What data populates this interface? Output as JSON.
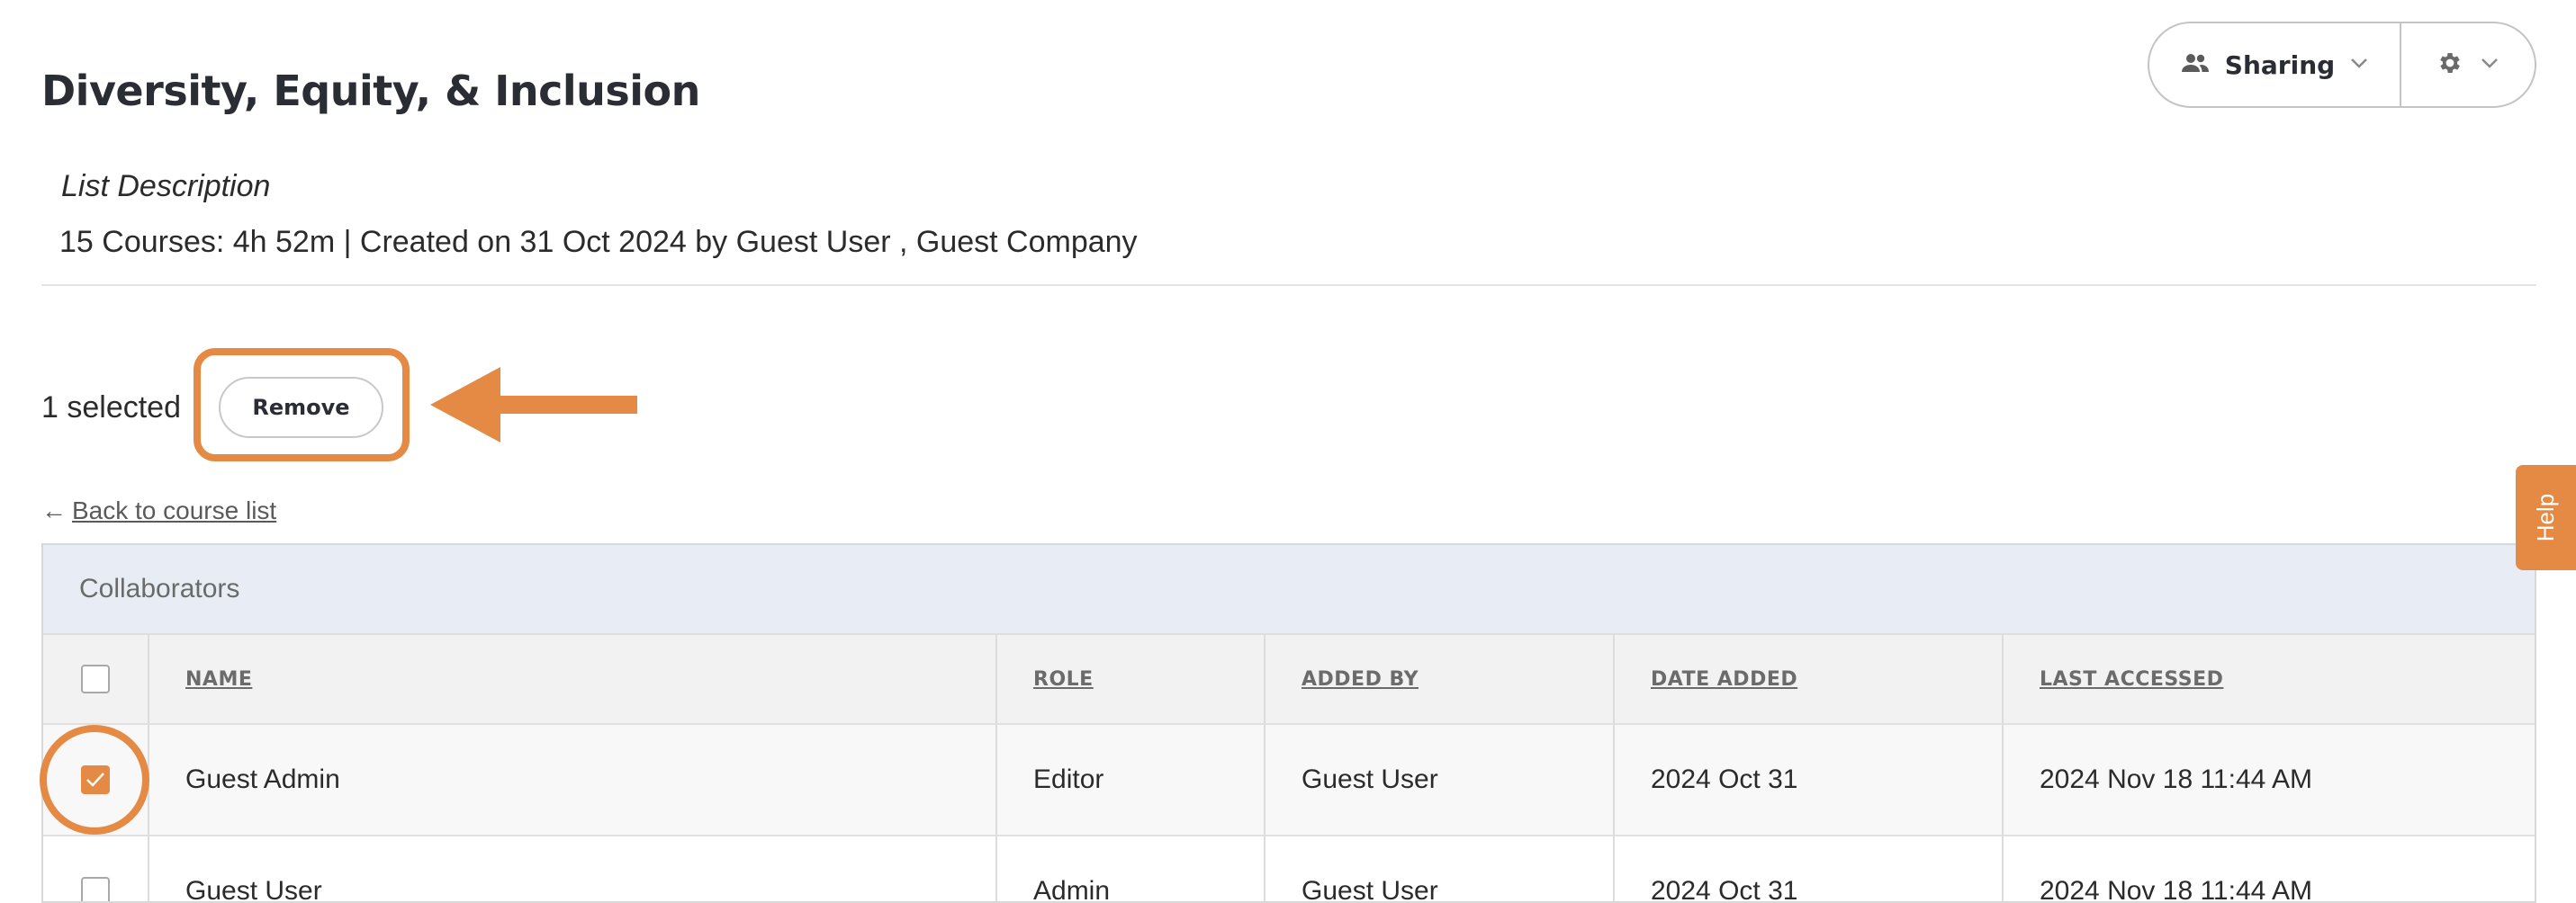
{
  "header": {
    "title": "Diversity, Equity, & Inclusion",
    "sharing_label": "Sharing",
    "icons": {
      "sharing": "people-icon",
      "sharing_chevron": "chevron-down-icon",
      "settings": "gear-icon",
      "settings_chevron": "chevron-down-icon"
    }
  },
  "list": {
    "description_label": "List Description",
    "meta": "15 Courses: 4h 52m | Created on 31 Oct 2024 by Guest User , Guest Company"
  },
  "selection": {
    "count_label": "1 selected",
    "remove_label": "Remove"
  },
  "nav": {
    "back_arrow": "←",
    "back_label": "Back to course list"
  },
  "table": {
    "caption": "Collaborators",
    "columns": [
      "NAME",
      "ROLE",
      "ADDED BY",
      "DATE ADDED",
      "LAST ACCESSED"
    ],
    "rows": [
      {
        "checked": true,
        "name": "Guest Admin",
        "role": "Editor",
        "added_by": "Guest User",
        "date_added": "2024 Oct 31",
        "last_accessed": "2024 Nov 18 11:44 AM"
      },
      {
        "checked": false,
        "name": "Guest User",
        "role": "Admin",
        "added_by": "Guest User",
        "date_added": "2024 Oct 31",
        "last_accessed": "2024 Nov 18 11:44 AM"
      }
    ]
  },
  "help": {
    "label": "Help"
  },
  "colors": {
    "accent": "#e58a45",
    "caption_bg": "#e8edf5",
    "header_bg": "#f2f2f2"
  }
}
